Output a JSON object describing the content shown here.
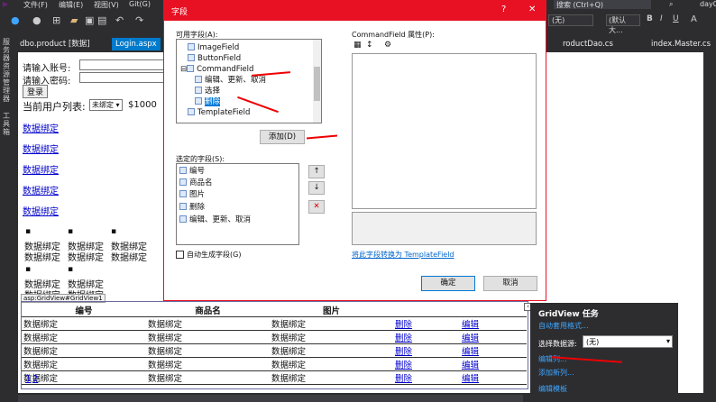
{
  "menubar": {
    "file": "文件(F)",
    "edit": "编辑(E)",
    "view": "视图(V)",
    "git": "Git(G)",
    "search": "搜索 (Ctrl+Q)",
    "day": "day0"
  },
  "toolbar": {
    "dropdown1": "(无)",
    "dropdown2": "(默认大...",
    "bold": "B",
    "italic": "I",
    "underline": "U",
    "fontcolor": "A"
  },
  "left_strip": {
    "label1": "服务器资源管理器",
    "label2": "工具箱"
  },
  "tabs": [
    {
      "label": "dbo.product [数据]"
    },
    {
      "label": "Login.aspx"
    },
    {
      "label": "roductDao.cs"
    },
    {
      "label": "index.Master.cs"
    }
  ],
  "page": {
    "account_label": "请输入账号:",
    "password_label": "请输入密码:",
    "login_button": "登录",
    "current_users_label": "当前用户列表:",
    "unbound": "未绑定",
    "price": "$1000",
    "links": [
      "数据绑定",
      "数据绑定",
      "数据绑定",
      "数据绑定",
      "数据绑定"
    ],
    "bound_text": "数据绑定",
    "gridview_tag": "asp:GridView#GridView1"
  },
  "gridview": {
    "headers": [
      "编号",
      "商品名",
      "图片",
      "",
      ""
    ],
    "rows": [
      [
        "数据绑定",
        "数据绑定",
        "数据绑定",
        "删除",
        "编辑"
      ],
      [
        "数据绑定",
        "数据绑定",
        "数据绑定",
        "删除",
        "编辑"
      ],
      [
        "数据绑定",
        "数据绑定",
        "数据绑定",
        "删除",
        "编辑"
      ],
      [
        "数据绑定",
        "数据绑定",
        "数据绑定",
        "删除",
        "编辑"
      ],
      [
        "数据绑定",
        "数据绑定",
        "数据绑定",
        "删除",
        "编辑"
      ]
    ],
    "pager": [
      "1",
      "2"
    ]
  },
  "dialog": {
    "title": "字段",
    "help": "?",
    "close": "✕",
    "available_label": "可用字段(A):",
    "available_items": [
      "ImageField",
      "ButtonField",
      "CommandField",
      "编辑、更新、取消",
      "选择",
      "删除",
      "TemplateField"
    ],
    "add_button": "添加(D)",
    "selected_label": "选定的字段(S):",
    "selected_items": [
      "编号",
      "商品名",
      "图片",
      "删除",
      "编辑、更新、取消"
    ],
    "auto_generate": "自动生成字段(G)",
    "properties_label": "CommandField 属性(P):",
    "convert_link": "将此字段转换为 TemplateField",
    "ok_button": "确定",
    "cancel_button": "取消",
    "up_symbol": "↑",
    "down_symbol": "↓",
    "delete_symbol": "✕"
  },
  "tasks_panel": {
    "title": "GridView 任务",
    "auto_format": "自动套用格式...",
    "choose_source": "选择数据源:",
    "source_value": "(无)",
    "edit_columns": "编辑列...",
    "add_column": "添加新列...",
    "edit_template": "编辑模板"
  },
  "colors": {
    "accent": "#007acc",
    "dialog_border": "#e81123",
    "link": "#0000cc",
    "arrow": "#e00000",
    "task_link": "#3ea6ff"
  }
}
